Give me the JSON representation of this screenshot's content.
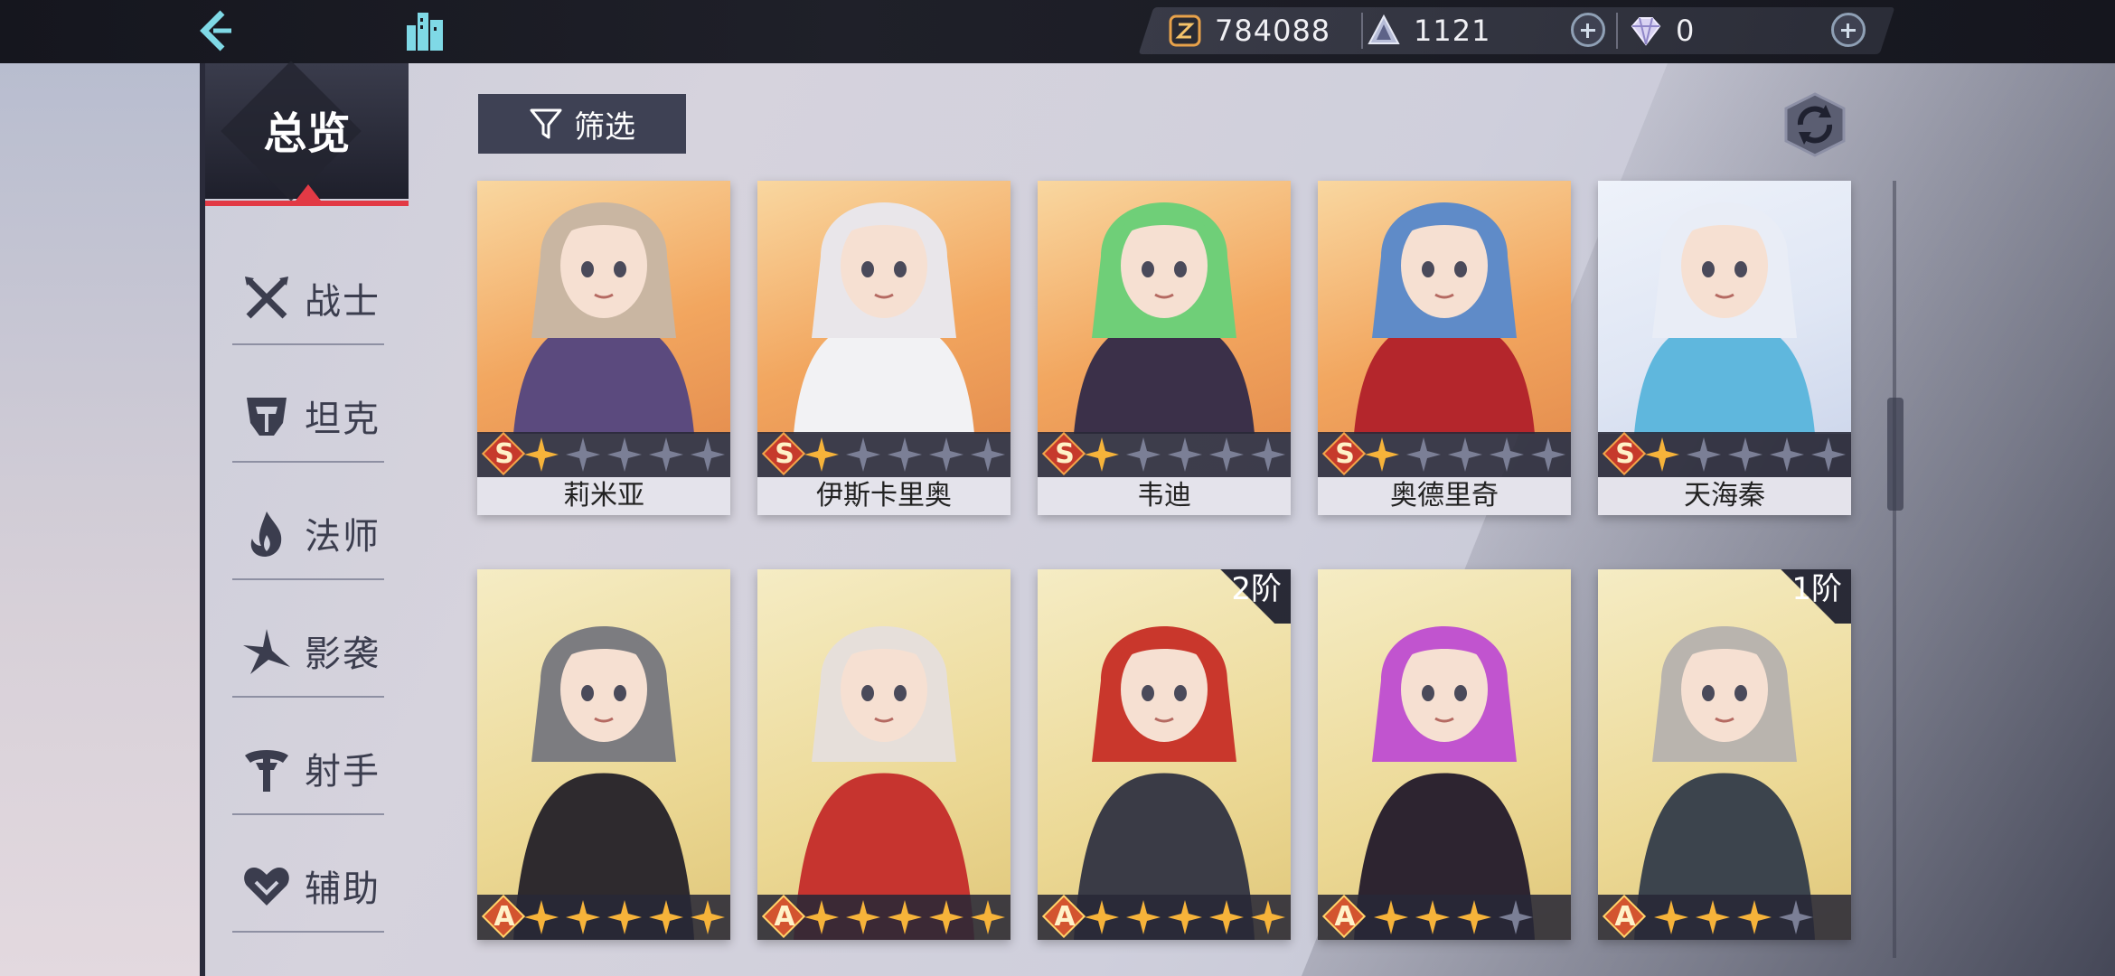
{
  "currencies": [
    {
      "icon": "gold-coin-icon",
      "value": "784088"
    },
    {
      "icon": "stamina-crystal-icon",
      "value": "1121"
    },
    {
      "icon": "diamond-icon",
      "value": "0"
    }
  ],
  "sidebar": {
    "overview": "总览",
    "items": [
      {
        "label": "战士",
        "icon": "crossed-swords-icon"
      },
      {
        "label": "坦克",
        "icon": "helmet-icon"
      },
      {
        "label": "法师",
        "icon": "flame-icon"
      },
      {
        "label": "影袭",
        "icon": "shadow-blade-icon"
      },
      {
        "label": "射手",
        "icon": "crossbow-icon"
      },
      {
        "label": "辅助",
        "icon": "heart-icon"
      }
    ]
  },
  "filter": {
    "label": "筛选"
  },
  "cards_row1": [
    {
      "name": "莉米亚",
      "rarity": "S",
      "stars_filled": 1,
      "stars_total": 5,
      "hair": "#c9b6a2",
      "outfit": "#5b4a7e"
    },
    {
      "name": "伊斯卡里奥",
      "rarity": "S",
      "stars_filled": 1,
      "stars_total": 5,
      "hair": "#e9e6ea",
      "outfit": "#f2f2f4"
    },
    {
      "name": "韦迪",
      "rarity": "S",
      "stars_filled": 1,
      "stars_total": 5,
      "hair": "#6fcf78",
      "outfit": "#3b3049"
    },
    {
      "name": "奥德里奇",
      "rarity": "S",
      "stars_filled": 1,
      "stars_total": 5,
      "hair": "#5f8bc8",
      "outfit": "#b4262c"
    },
    {
      "name": "天海秦",
      "rarity": "S",
      "stars_filled": 1,
      "stars_total": 5,
      "hair": "#e9edf6",
      "outfit": "#5fb7dd"
    }
  ],
  "cards_row2": [
    {
      "rarity": "A",
      "stars_filled": 5,
      "stars_total": 5,
      "rank": "",
      "hair": "#7c7c80",
      "outfit": "#2e2a2e"
    },
    {
      "rarity": "A",
      "stars_filled": 5,
      "stars_total": 5,
      "rank": "",
      "hair": "#e6dfda",
      "outfit": "#c6342f"
    },
    {
      "rarity": "A",
      "stars_filled": 5,
      "stars_total": 5,
      "rank": "2阶",
      "hair": "#c9372c",
      "outfit": "#3a3b46"
    },
    {
      "rarity": "A",
      "stars_filled": 3,
      "stars_total": 4,
      "rank": "",
      "hair": "#c154cf",
      "outfit": "#2d2430"
    },
    {
      "rarity": "A",
      "stars_filled": 3,
      "stars_total": 4,
      "rank": "1阶",
      "hair": "#b9b4ae",
      "outfit": "#3c444d"
    }
  ],
  "colors": {
    "accent": "#e23a45",
    "panel": "#3e4154",
    "star_filled": "#f6b33a",
    "star_empty": "#7b7f96"
  }
}
